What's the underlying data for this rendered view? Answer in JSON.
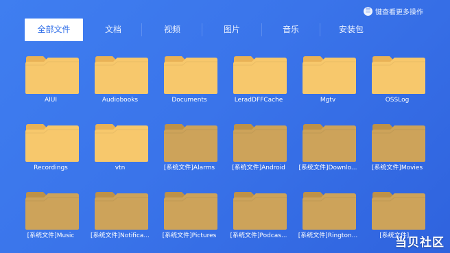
{
  "header": {
    "hint_icon": "menu-icon",
    "hint_text": "键查看更多操作"
  },
  "tabs": [
    {
      "label": "全部文件",
      "active": true
    },
    {
      "label": "文档",
      "active": false
    },
    {
      "label": "视频",
      "active": false
    },
    {
      "label": "图片",
      "active": false
    },
    {
      "label": "音乐",
      "active": false
    },
    {
      "label": "安装包",
      "active": false
    }
  ],
  "colors": {
    "folder_user": "#f7c86c",
    "folder_user_back": "#e9b256",
    "folder_system": "#cda35a",
    "folder_system_back": "#bd9148",
    "active_tab_text": "#2f6ee8"
  },
  "folders": [
    {
      "name": "AIUI",
      "kind": "user"
    },
    {
      "name": "Audiobooks",
      "kind": "user"
    },
    {
      "name": "Documents",
      "kind": "user"
    },
    {
      "name": "LeradDFFCache",
      "kind": "user"
    },
    {
      "name": "Mgtv",
      "kind": "user"
    },
    {
      "name": "OSSLog",
      "kind": "user"
    },
    {
      "name": "Recordings",
      "kind": "user"
    },
    {
      "name": "vtn",
      "kind": "user"
    },
    {
      "name": "[系统文件]Alarms",
      "kind": "system"
    },
    {
      "name": "[系统文件]Android",
      "kind": "system"
    },
    {
      "name": "[系统文件]Downlo...",
      "kind": "system"
    },
    {
      "name": "[系统文件]Movies",
      "kind": "system"
    },
    {
      "name": "[系统文件]Music",
      "kind": "system"
    },
    {
      "name": "[系统文件]Notifica...",
      "kind": "system"
    },
    {
      "name": "[系统文件]Pictures",
      "kind": "system"
    },
    {
      "name": "[系统文件]Podcas...",
      "kind": "system"
    },
    {
      "name": "[系统文件]Rington...",
      "kind": "system"
    },
    {
      "name": "[系统文件]...",
      "kind": "system"
    }
  ],
  "watermark": "当贝社区"
}
